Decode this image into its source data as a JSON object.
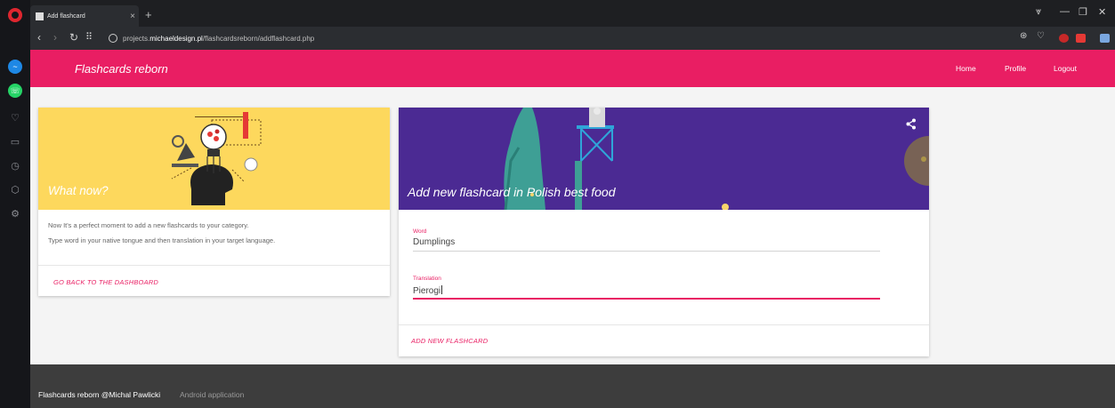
{
  "browser": {
    "tab_title": "Add flashcard",
    "tab_close": "×",
    "new_tab": "+",
    "url_prefix": "projects.",
    "url_domain": "michaeldesign.pl",
    "url_path": "/flashcardsreborn/addflashcard.php"
  },
  "navbar": {
    "brand": "Flashcards reborn",
    "links": [
      "Home",
      "Profile",
      "Logout"
    ]
  },
  "info_card": {
    "title": "What now?",
    "line1": "Now It's a perfect moment to add a new flashcards to your category.",
    "line2": "Type word in your native tongue and then translation in your target language.",
    "action": "GO BACK TO THE DASHBOARD"
  },
  "form_card": {
    "title": "Add new flashcard in Polish best food",
    "word_label": "Word",
    "word_value": "Dumplings",
    "translation_label": "Translation",
    "translation_value": "Pierogi",
    "action": "ADD NEW FLASHCARD"
  },
  "footer": {
    "main": "Flashcards reborn @Michal Pawlicki",
    "sub": "Android application"
  },
  "colors": {
    "accent": "#e91e63",
    "navbar": "#e91e63",
    "info_hero": "#fdd85d",
    "form_hero": "#4b2a93",
    "footer": "#3d3d3d"
  },
  "icons": {
    "sidebar": [
      "opera-logo-icon",
      "messenger-icon",
      "whatsapp-icon",
      "heart-icon",
      "tabs-icon",
      "history-icon",
      "cube-icon",
      "settings-icon"
    ],
    "form_hero": "share-icon"
  }
}
